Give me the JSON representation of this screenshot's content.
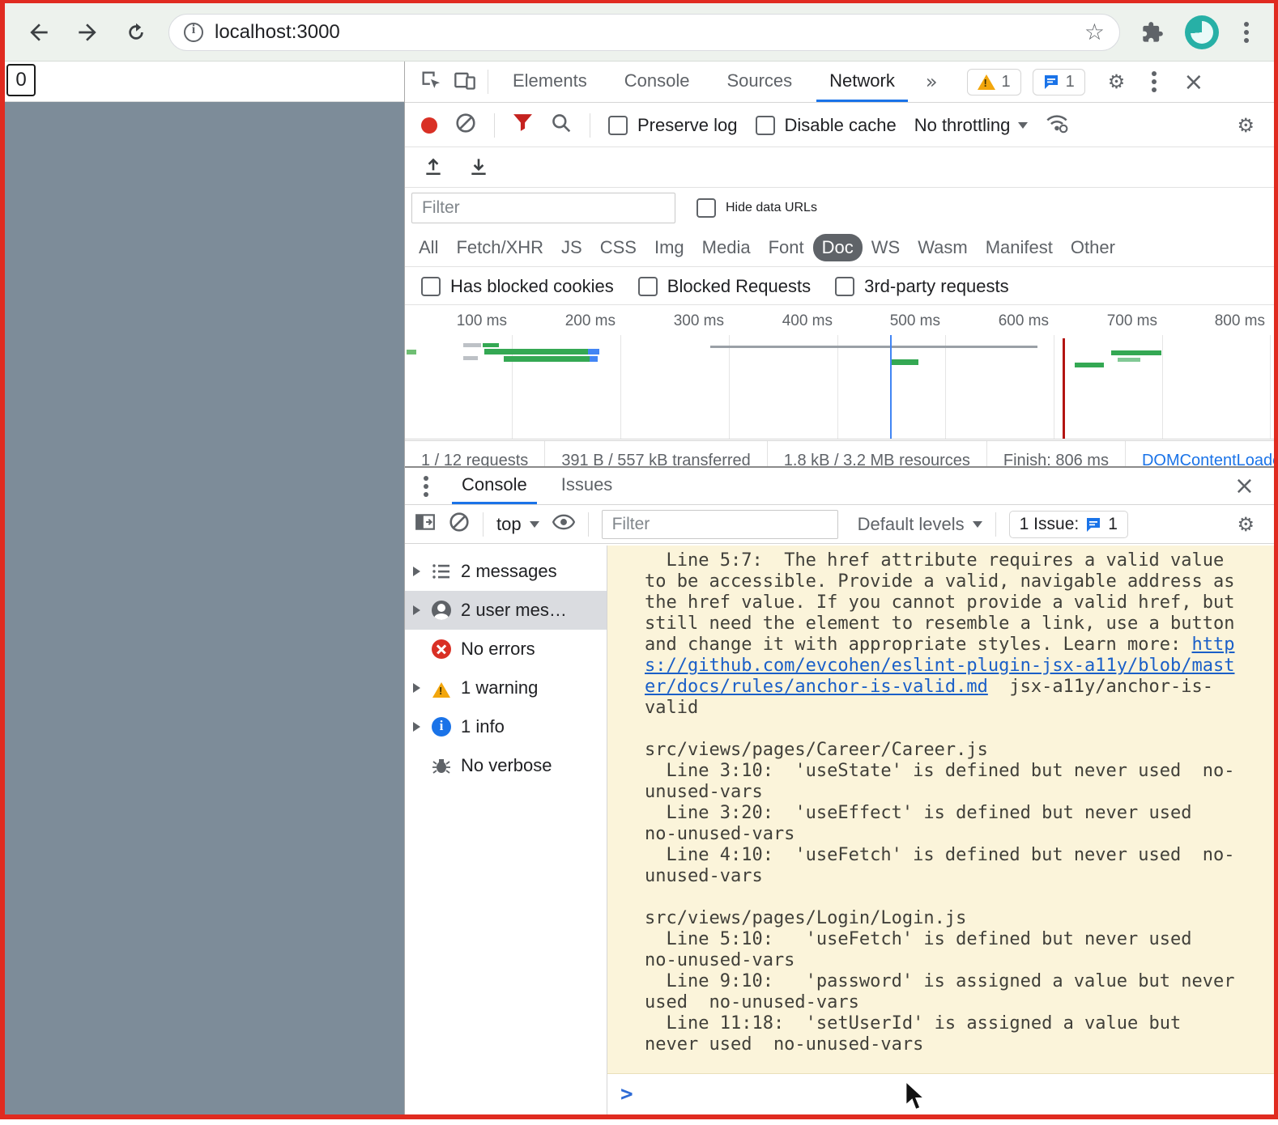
{
  "icons": {
    "gear": "⚙",
    "star": "☆",
    "more_tabs": "»",
    "close": "×",
    "prompt": ">"
  },
  "browser": {
    "url": "localhost:3000",
    "page_overlay_label": "0"
  },
  "devtools": {
    "tabs": {
      "elements": "Elements",
      "console": "Console",
      "sources": "Sources",
      "network": "Network"
    },
    "badges": {
      "warnings": "1",
      "messages": "1"
    },
    "network": {
      "preserve_log": "Preserve log",
      "disable_cache": "Disable cache",
      "throttling": "No throttling",
      "filter_placeholder": "Filter",
      "hide_data_urls": "Hide data URLs",
      "chips": [
        "All",
        "Fetch/XHR",
        "JS",
        "CSS",
        "Img",
        "Media",
        "Font",
        "Doc",
        "WS",
        "Wasm",
        "Manifest",
        "Other"
      ],
      "selected_chip": "Doc",
      "checks": [
        "Has blocked cookies",
        "Blocked Requests",
        "3rd-party requests"
      ],
      "times": [
        "100 ms",
        "200 ms",
        "300 ms",
        "400 ms",
        "500 ms",
        "600 ms",
        "700 ms",
        "800 ms"
      ],
      "summary": [
        "1 / 12 requests",
        "391 B / 557 kB transferred",
        "1.8 kB / 3.2 MB resources",
        "Finish: 806 ms",
        "DOMContentLoaded:"
      ]
    },
    "drawer": {
      "tab_console": "Console",
      "tab_issues": "Issues",
      "context": "top",
      "filter_placeholder": "Filter",
      "levels": "Default levels",
      "issue_label": "1 Issue:",
      "issue_count": "1",
      "sidebar": [
        {
          "label": "2 messages"
        },
        {
          "label": "2 user mes…"
        },
        {
          "label": "No errors"
        },
        {
          "label": "1 warning"
        },
        {
          "label": "1 info"
        },
        {
          "label": "No verbose"
        }
      ],
      "console_blocks": {
        "b0_pre": "  Line 5:7:  The href attribute requires a valid value to be accessible. Provide a valid, navigable address as the href value. If you cannot provide a valid href, but still need the element to resemble a link, use a button and change it with appropriate styles. Learn more: ",
        "b0_link": "https://github.com/evcohen/eslint-plugin-jsx-a11y/blob/master/docs/rules/anchor-is-valid.md",
        "b0_post": "  jsx-a11y/anchor-is-valid",
        "b1": "src/views/pages/Career/Career.js\n  Line 3:10:  'useState' is defined but never used  no-unused-vars\n  Line 3:20:  'useEffect' is defined but never used  no-unused-vars\n  Line 4:10:  'useFetch' is defined but never used  no-unused-vars",
        "b2": "src/views/pages/Login/Login.js\n  Line 5:10:   'useFetch' is defined but never used  no-unused-vars\n  Line 9:10:   'password' is assigned a value but never used  no-unused-vars\n  Line 11:18:  'setUserId' is assigned a value but never used  no-unused-vars"
      }
    }
  }
}
